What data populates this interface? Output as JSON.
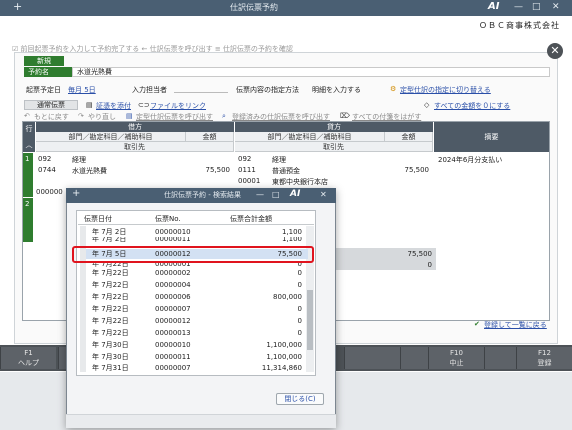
{
  "window": {
    "title": "仕訳伝票予約",
    "plus": "+",
    "brand": "AI",
    "minimize": "—",
    "maximize": "□",
    "close": "✕",
    "company": "ＯＢＣ商事株式会社"
  },
  "form": {
    "ghost_text": "☑ 前回起票予約を入力して予約完了する  ← 仕訳伝票を呼び出す  ≡ 仕訳伝票の予約を確認",
    "tab_new": "新規",
    "reservation_label": "予約名",
    "reservation_value": "水道光熱費",
    "issue_date_label": "起票予定日",
    "issue_date_value": "毎月 5日",
    "person_label": "入力担当者",
    "method_label": "伝票内容の指定方法",
    "method_value": "明細を入力する",
    "switch_link": "定型仕訳の指定に切り替える",
    "voucher_type": "通常伝票",
    "attach_link": "証憑を添付",
    "file_link": "ファイルをリンク",
    "zero_link": "すべての金額を０にする",
    "undo": "もとに戻す",
    "redo": "やり直し",
    "call_template": "定型仕訳伝票を呼び出す",
    "call_registered": "登録済みの仕訳伝票を呼び出す",
    "remove_all": "すべての付箋をはがす",
    "grid": {
      "row_header": "行",
      "debit": "借方",
      "credit": "貸方",
      "subheader": "部門／勘定科目／補助科目",
      "amount": "金額",
      "partner": "取引先",
      "memo": "摘要",
      "row1_no": "1",
      "row2_no": "2",
      "debit_dept": "092",
      "debit_account_code": "0744",
      "debit_dept_name": "経理",
      "debit_account_name": "水道光熱費",
      "debit_amount": "75,500",
      "debit_row2_code": "000000",
      "credit_dept": "092",
      "credit_account_code": "0111",
      "credit_sub_code": "00001",
      "credit_dept_name": "経理",
      "credit_account_name": "普通預金",
      "credit_sub_name": "東都中央銀行本店",
      "credit_amount": "75,500",
      "memo_text": "2024年6月分支払い",
      "total_amount": "75,500",
      "total_zero": "0"
    },
    "register_link": "登録して一覧に戻る"
  },
  "fkeys": [
    {
      "key": "F1",
      "label": "ヘルプ"
    },
    {
      "key": "F10",
      "label": "中止"
    },
    {
      "key": "F12",
      "label": "登録"
    }
  ],
  "dialog": {
    "title": "仕訳伝票予約 - 検索結果",
    "col_date": "伝票日付",
    "col_no": "伝票No.",
    "col_amount": "伝票合計金額",
    "rows": [
      {
        "date": "年  7月  2日",
        "no": "00000010",
        "amount": "1,100"
      },
      {
        "date": "年  7月  2日",
        "no": "00000011",
        "amount": "1,100"
      },
      {
        "date": "年  7月  5日",
        "no": "00000012",
        "amount": "75,500"
      },
      {
        "date": "年  7月22日",
        "no": "00000001",
        "amount": "0"
      },
      {
        "date": "年  7月22日",
        "no": "00000002",
        "amount": "0"
      },
      {
        "date": "年  7月22日",
        "no": "00000004",
        "amount": "0"
      },
      {
        "date": "年  7月22日",
        "no": "00000006",
        "amount": "800,000"
      },
      {
        "date": "年  7月22日",
        "no": "00000007",
        "amount": "0"
      },
      {
        "date": "年  7月22日",
        "no": "00000012",
        "amount": "0"
      },
      {
        "date": "年  7月22日",
        "no": "00000013",
        "amount": "0"
      },
      {
        "date": "年  7月30日",
        "no": "00000010",
        "amount": "1,100,000"
      },
      {
        "date": "年  7月30日",
        "no": "00000011",
        "amount": "1,100,000"
      },
      {
        "date": "年  7月31日",
        "no": "00000007",
        "amount": "11,314,860"
      }
    ],
    "close_button": "閉じる(C)"
  },
  "colors": {
    "titlebar": "#4a5f73",
    "green": "#2f7d2f",
    "highlight": "#e0141e",
    "selected_row": "#d3e1f3"
  }
}
